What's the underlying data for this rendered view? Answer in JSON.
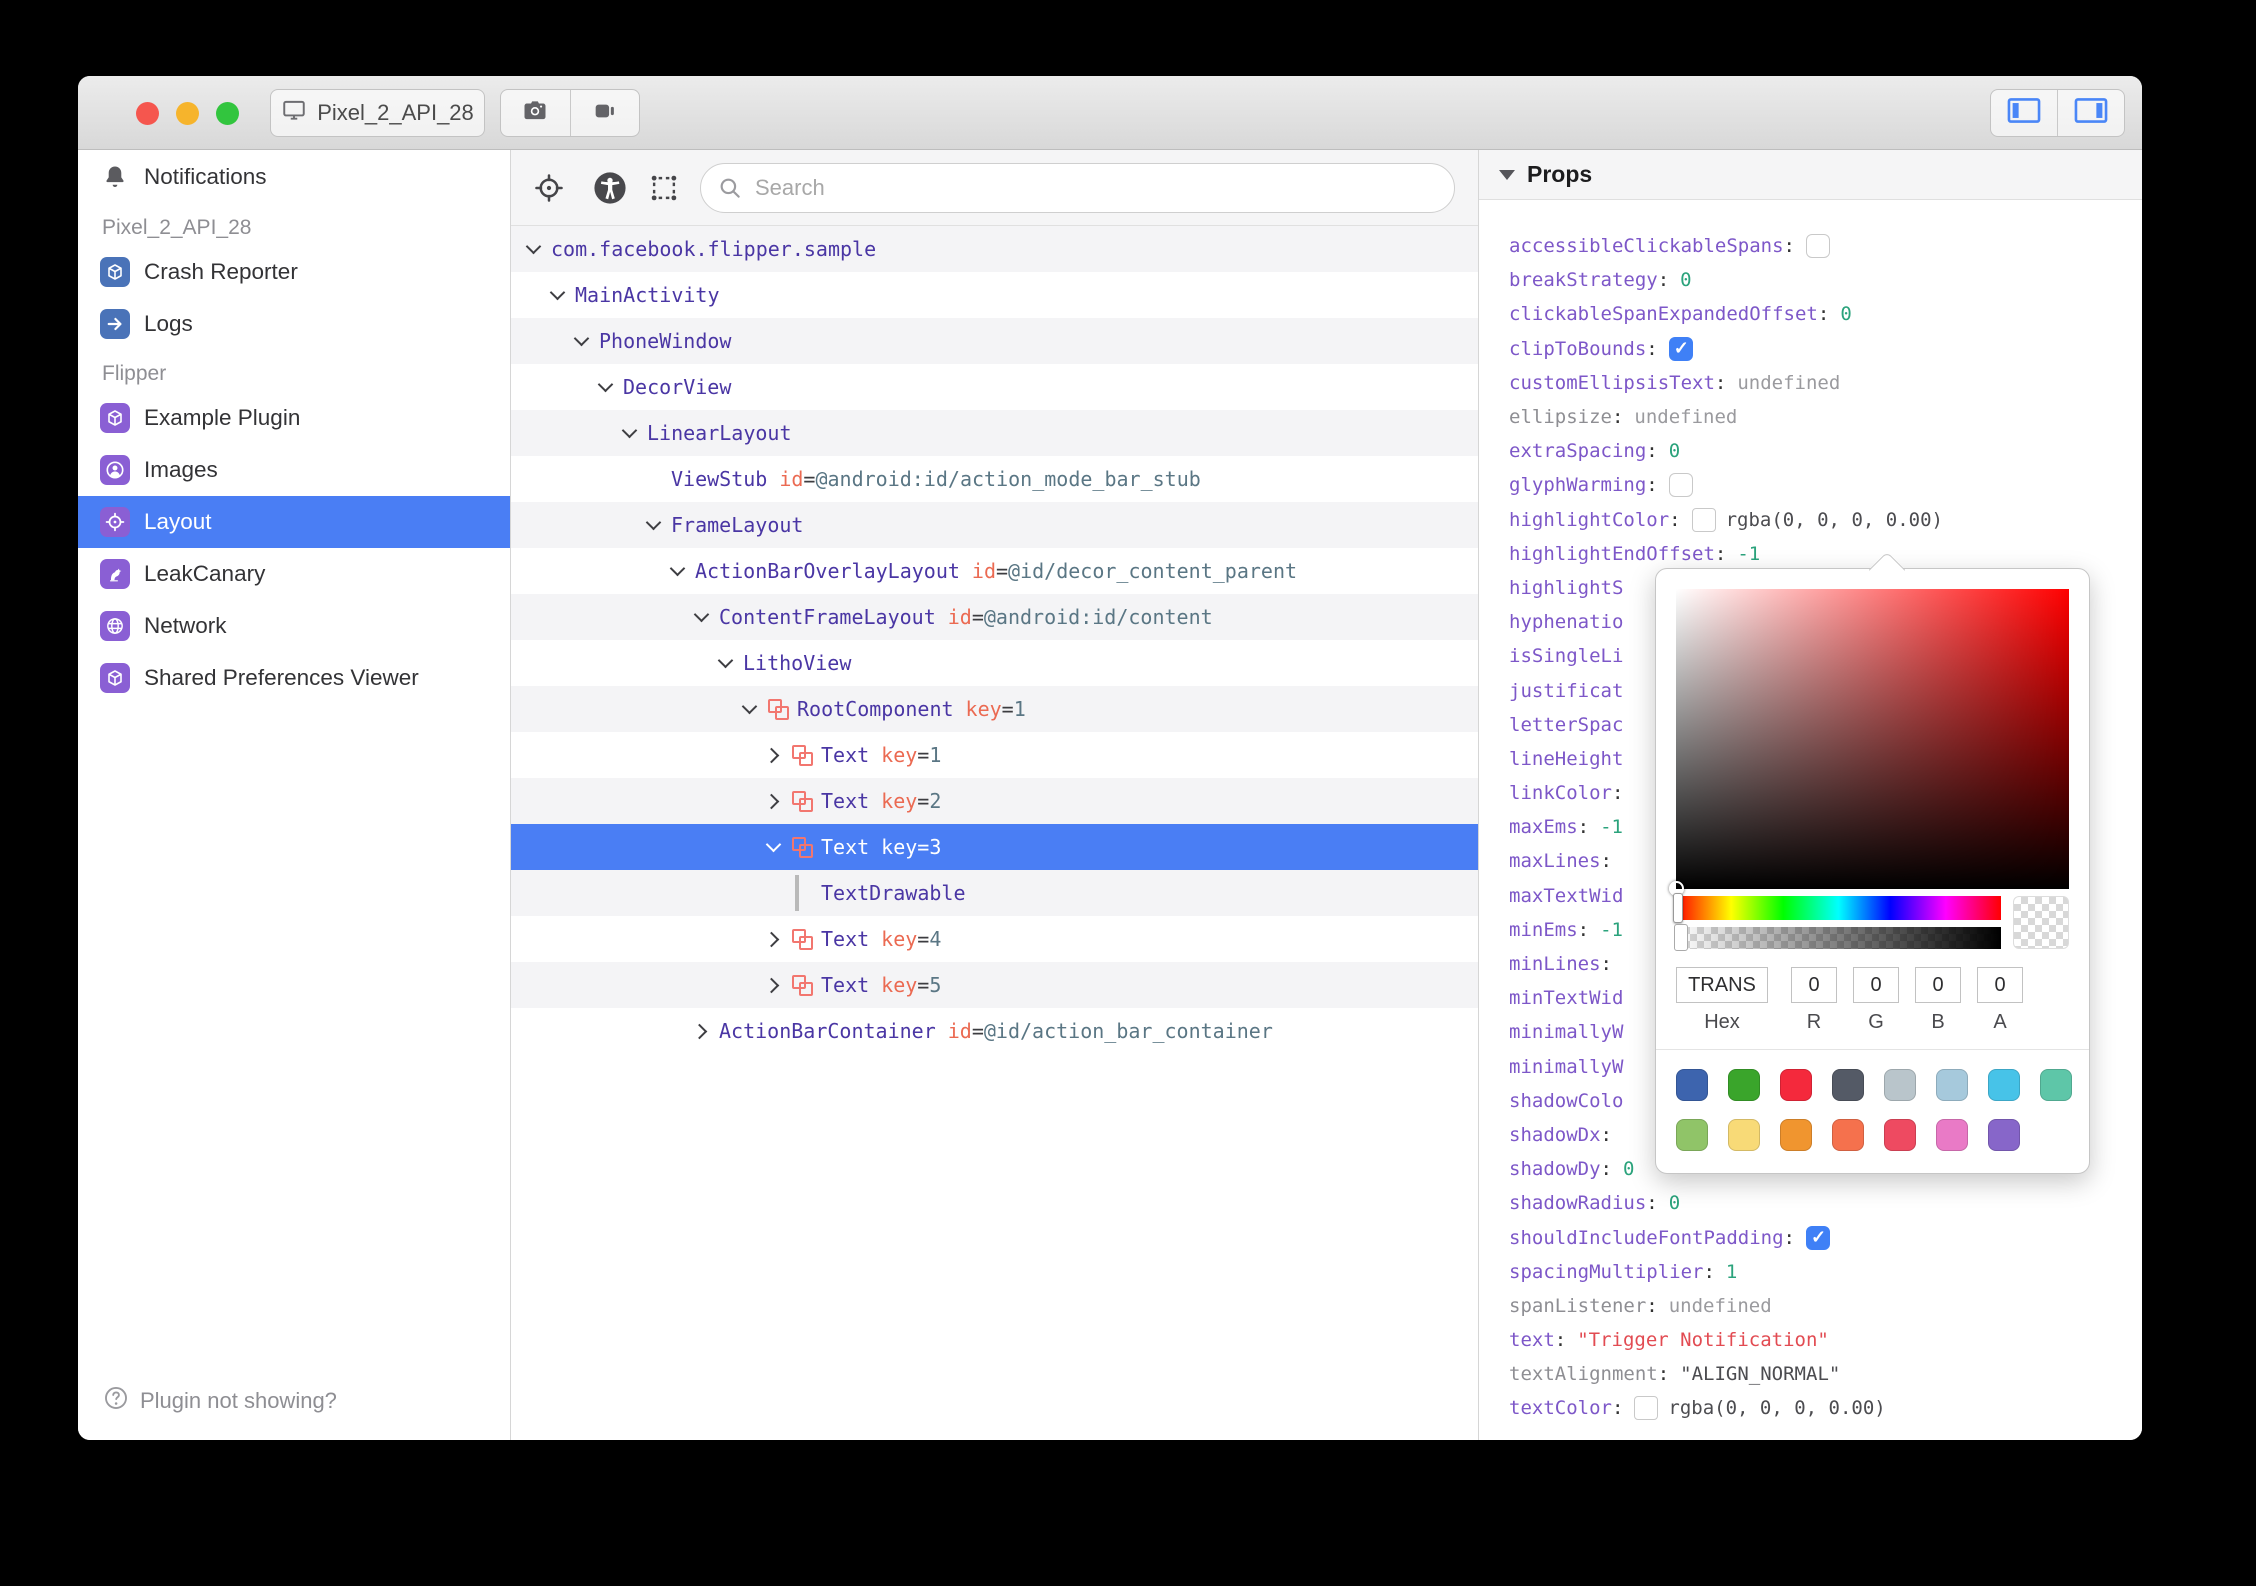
{
  "titlebar": {
    "device": "Pixel_2_API_28"
  },
  "syntax": {
    "eq": "="
  },
  "colors": {
    "accent_blue": "#4a7ef4",
    "plugin_blue": "#4a73b8",
    "plugin_purple": "#8a5fd4",
    "litho_pink": "#f2766f",
    "checkbox_blue": "#3f80f6",
    "number_green": "#2ba37c",
    "string_red": "#e24b52",
    "prop_purple": "#7d57c8"
  },
  "sidebar": {
    "items": [
      {
        "kind": "item",
        "icon": "bell-icon",
        "chip": null,
        "label": "Notifications",
        "selected": false
      },
      {
        "kind": "section",
        "label": "Pixel_2_API_28"
      },
      {
        "kind": "item",
        "icon": "cube-icon",
        "chip": "blue",
        "label": "Crash Reporter",
        "selected": false
      },
      {
        "kind": "item",
        "icon": "arrow-right-icon",
        "chip": "blue",
        "label": "Logs",
        "selected": false
      },
      {
        "kind": "section",
        "label": "Flipper"
      },
      {
        "kind": "item",
        "icon": "cube-icon",
        "chip": "purple",
        "label": "Example Plugin",
        "selected": false
      },
      {
        "kind": "item",
        "icon": "person-circle-icon",
        "chip": "purple",
        "label": "Images",
        "selected": false
      },
      {
        "kind": "item",
        "icon": "target-icon",
        "chip": "purple",
        "label": "Layout",
        "selected": true
      },
      {
        "kind": "item",
        "icon": "bird-icon",
        "chip": "purple",
        "label": "LeakCanary",
        "selected": false
      },
      {
        "kind": "item",
        "icon": "globe-icon",
        "chip": "purple",
        "label": "Network",
        "selected": false
      },
      {
        "kind": "item",
        "icon": "cube-icon",
        "chip": "purple",
        "label": "Shared Preferences Viewer",
        "selected": false
      }
    ],
    "footer": "Plugin not showing?"
  },
  "toolbar": {
    "search_placeholder": "Search"
  },
  "tree": {
    "rows": [
      {
        "depth": 0,
        "chevron": "down",
        "icon": "none",
        "name": "com.facebook.flipper.sample",
        "attr": null,
        "selected": false
      },
      {
        "depth": 1,
        "chevron": "down",
        "icon": "none",
        "name": "MainActivity",
        "attr": null,
        "selected": false
      },
      {
        "depth": 2,
        "chevron": "down",
        "icon": "none",
        "name": "PhoneWindow",
        "attr": null,
        "selected": false
      },
      {
        "depth": 3,
        "chevron": "down",
        "icon": "none",
        "name": "DecorView",
        "attr": null,
        "selected": false
      },
      {
        "depth": 4,
        "chevron": "down",
        "icon": "none",
        "name": "LinearLayout",
        "attr": null,
        "selected": false
      },
      {
        "depth": 5,
        "chevron": "none",
        "icon": "none",
        "name": "ViewStub",
        "attr": {
          "key": "id",
          "value": "@android:id/action_mode_bar_stub"
        },
        "selected": false
      },
      {
        "depth": 5,
        "chevron": "down",
        "icon": "none",
        "name": "FrameLayout",
        "attr": null,
        "selected": false
      },
      {
        "depth": 6,
        "chevron": "down",
        "icon": "none",
        "name": "ActionBarOverlayLayout",
        "attr": {
          "key": "id",
          "value": "@id/decor_content_parent"
        },
        "selected": false
      },
      {
        "depth": 7,
        "chevron": "down",
        "icon": "none",
        "name": "ContentFrameLayout",
        "attr": {
          "key": "id",
          "value": "@android:id/content"
        },
        "selected": false
      },
      {
        "depth": 8,
        "chevron": "down",
        "icon": "none",
        "name": "LithoView",
        "attr": null,
        "selected": false
      },
      {
        "depth": 9,
        "chevron": "down",
        "icon": "litho",
        "name": "RootComponent",
        "attr": {
          "key": "key",
          "value": "1"
        },
        "selected": false
      },
      {
        "depth": 10,
        "chevron": "right",
        "icon": "litho",
        "name": "Text",
        "attr": {
          "key": "key",
          "value": "1"
        },
        "selected": false
      },
      {
        "depth": 10,
        "chevron": "right",
        "icon": "litho",
        "name": "Text",
        "attr": {
          "key": "key",
          "value": "2"
        },
        "selected": false
      },
      {
        "depth": 10,
        "chevron": "down",
        "icon": "litho",
        "name": "Text",
        "attr": {
          "key": "key",
          "value": "3"
        },
        "selected": true
      },
      {
        "depth": 11,
        "chevron": "bar",
        "icon": "none",
        "name": "TextDrawable",
        "attr": null,
        "selected": false
      },
      {
        "depth": 10,
        "chevron": "right",
        "icon": "litho",
        "name": "Text",
        "attr": {
          "key": "key",
          "value": "4"
        },
        "selected": false
      },
      {
        "depth": 10,
        "chevron": "right",
        "icon": "litho",
        "name": "Text",
        "attr": {
          "key": "key",
          "value": "5"
        },
        "selected": false
      },
      {
        "depth": 7,
        "chevron": "right",
        "icon": "none",
        "name": "ActionBarContainer",
        "attr": {
          "key": "id",
          "value": "@id/action_bar_container"
        },
        "selected": false
      }
    ]
  },
  "props": {
    "header": "Props",
    "rows": [
      {
        "label": "accessibleClickableSpans:",
        "gray": false,
        "type": "checkbox",
        "checked": false,
        "value": ""
      },
      {
        "label": "breakStrategy:",
        "gray": false,
        "type": "num",
        "value": "0"
      },
      {
        "label": "clickableSpanExpandedOffset:",
        "gray": false,
        "type": "num",
        "value": "0"
      },
      {
        "label": "clipToBounds:",
        "gray": false,
        "type": "checkbox",
        "checked": true,
        "value": ""
      },
      {
        "label": "customEllipsisText:",
        "gray": false,
        "type": "undef",
        "value": "undefined"
      },
      {
        "label": "ellipsize:",
        "gray": true,
        "type": "undef",
        "value": "undefined"
      },
      {
        "label": "extraSpacing:",
        "gray": false,
        "type": "num",
        "value": "0"
      },
      {
        "label": "glyphWarming:",
        "gray": false,
        "type": "checkbox",
        "checked": false,
        "value": ""
      },
      {
        "label": "highlightColor:",
        "gray": false,
        "type": "color",
        "value": "rgba(0, 0, 0, 0.00)"
      },
      {
        "label": "highlightEndOffset:",
        "gray": false,
        "type": "num",
        "value": "-1"
      },
      {
        "label": "highlightS",
        "gray": false,
        "type": "none",
        "value": ""
      },
      {
        "label": "hyphenatio",
        "gray": false,
        "type": "none",
        "value": ""
      },
      {
        "label": "isSingleLi",
        "gray": false,
        "type": "none",
        "value": ""
      },
      {
        "label": "justificat",
        "gray": false,
        "type": "none",
        "value": ""
      },
      {
        "label": "letterSpac",
        "gray": false,
        "type": "none",
        "value": ""
      },
      {
        "label": "lineHeight",
        "gray": false,
        "type": "none",
        "value": ""
      },
      {
        "label": "linkColor:",
        "gray": false,
        "type": "none",
        "value": ""
      },
      {
        "label": "maxEms:",
        "gray": false,
        "type": "num",
        "value": "-1"
      },
      {
        "label": "maxLines:",
        "gray": false,
        "type": "none",
        "value": ""
      },
      {
        "label": "maxTextWid",
        "gray": false,
        "type": "none",
        "value": ""
      },
      {
        "label": "minEms:",
        "gray": false,
        "type": "num",
        "value": "-1"
      },
      {
        "label": "minLines:",
        "gray": false,
        "type": "none",
        "value": ""
      },
      {
        "label": "minTextWid",
        "gray": false,
        "type": "none",
        "value": ""
      },
      {
        "label": "minimallyW",
        "gray": false,
        "type": "none",
        "value": ""
      },
      {
        "label": "minimallyW",
        "gray": false,
        "type": "none",
        "value": ""
      },
      {
        "label": "shadowColo",
        "gray": false,
        "type": "none",
        "value": ""
      },
      {
        "label": "shadowDx:",
        "gray": false,
        "type": "none",
        "value": ""
      },
      {
        "label": "shadowDy:",
        "gray": false,
        "type": "num",
        "value": "0"
      },
      {
        "label": "shadowRadius:",
        "gray": false,
        "type": "num",
        "value": "0"
      },
      {
        "label": "shouldIncludeFontPadding:",
        "gray": false,
        "type": "checkbox",
        "checked": true,
        "value": ""
      },
      {
        "label": "spacingMultiplier:",
        "gray": false,
        "type": "num",
        "value": "1"
      },
      {
        "label": "spanListener:",
        "gray": true,
        "type": "undef",
        "value": "undefined"
      },
      {
        "label": "text:",
        "gray": false,
        "type": "str",
        "value": "\"Trigger Notification\""
      },
      {
        "label": "textAlignment:",
        "gray": true,
        "type": "strdark",
        "value": "\"ALIGN_NORMAL\""
      },
      {
        "label": "textColor:",
        "gray": false,
        "type": "color",
        "value": "rgba(0, 0, 0, 0.00)"
      }
    ]
  },
  "picker": {
    "hex": "TRANS",
    "r": "0",
    "g": "0",
    "b": "0",
    "a": "0",
    "labels": {
      "hex": "Hex",
      "r": "R",
      "g": "G",
      "b": "B",
      "a": "A"
    },
    "swatches": {
      "row1": [
        "#3d64ae",
        "#3aa52b",
        "#f4293c",
        "#545a66",
        "#b9c5cb",
        "#a6c9dc",
        "#47c3e8",
        "#5ec6a8"
      ],
      "row2": [
        "#90c468",
        "#f8da77",
        "#f0952f",
        "#f5714d",
        "#ee4a61",
        "#e97ac6",
        "#8766c9"
      ]
    }
  }
}
